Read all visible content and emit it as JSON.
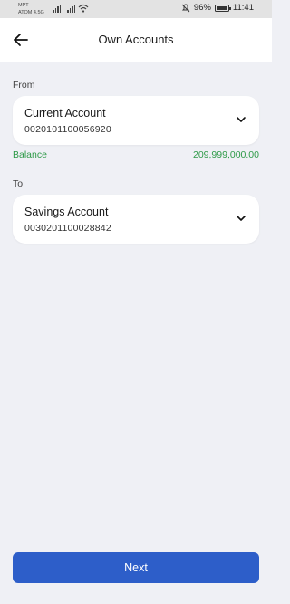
{
  "status_bar": {
    "carrier_line1": "MPT",
    "carrier_line2": "ATOM 4.5G",
    "battery": "96%",
    "time": "11:41",
    "icons": [
      "signal-icon",
      "signal-icon",
      "wifi-icon",
      "mute-icon",
      "battery-icon"
    ]
  },
  "header": {
    "title": "Own Accounts",
    "back_icon": "arrow-left-icon"
  },
  "from": {
    "label": "From",
    "account_name": "Current Account",
    "account_number": "0020101100056920",
    "balance_label": "Balance",
    "balance_value": "209,999,000.00"
  },
  "to": {
    "label": "To",
    "account_name": "Savings Account",
    "account_number": "0030201100028842"
  },
  "next_label": "Next",
  "colors": {
    "background": "#eff0f5",
    "primary": "#2d5ec9",
    "balance": "#2e9a48"
  }
}
